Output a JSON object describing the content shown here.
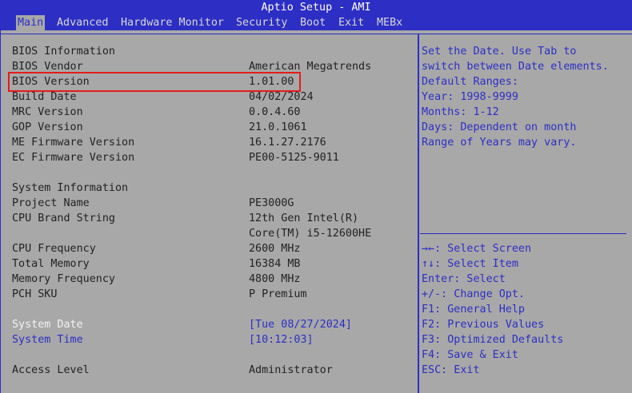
{
  "window": {
    "title": "Aptio Setup - AMI"
  },
  "menu": {
    "tabs": [
      {
        "label": "Main"
      },
      {
        "label": "Advanced"
      },
      {
        "label": "Hardware Monitor"
      },
      {
        "label": "Security"
      },
      {
        "label": "Boot"
      },
      {
        "label": "Exit"
      },
      {
        "label": "MEBx"
      }
    ]
  },
  "bios_info": {
    "heading": "BIOS Information",
    "rows": [
      {
        "label": "BIOS Vendor",
        "value": "American Megatrends"
      },
      {
        "label": "BIOS Version",
        "value": "1.01.00"
      },
      {
        "label": "Build Date",
        "value": "04/02/2024"
      },
      {
        "label": "MRC Version",
        "value": "0.0.4.60"
      },
      {
        "label": "GOP Version",
        "value": "21.0.1061"
      },
      {
        "label": "ME Firmware Version",
        "value": "16.1.27.2176"
      },
      {
        "label": "EC Firmware Version",
        "value": "PE00-5125-9011"
      }
    ]
  },
  "system_info": {
    "heading": "System Information",
    "rows": [
      {
        "label": "Project Name",
        "value": "PE3000G"
      },
      {
        "label": "CPU Brand String",
        "value": "12th Gen Intel(R)"
      },
      {
        "label": "",
        "value": "Core(TM) i5-12600HE"
      },
      {
        "label": "CPU Frequency",
        "value": "2600 MHz"
      },
      {
        "label": "Total Memory",
        "value": "16384 MB"
      },
      {
        "label": "Memory Frequency",
        "value": "4800 MHz"
      },
      {
        "label": "PCH SKU",
        "value": "P Premium"
      }
    ]
  },
  "system_date": {
    "label": "System Date",
    "value": "[Tue 08/27/2024]"
  },
  "system_time": {
    "label": "System Time",
    "value": "[10:12:03]"
  },
  "access_level": {
    "label": "Access Level",
    "value": "Administrator"
  },
  "help_text": [
    "Set the Date. Use Tab to",
    "switch between Date elements.",
    "Default Ranges:",
    "Year: 1998-9999",
    "Months: 1-12",
    "Days: Dependent on month",
    "Range of Years may vary."
  ],
  "key_help": [
    "→←: Select Screen",
    "↑↓: Select Item",
    "Enter: Select",
    "+/-: Change Opt.",
    "F1: General Help",
    "F2: Previous Values",
    "F3: Optimized Defaults",
    "F4: Save & Exit",
    "ESC: Exit"
  ],
  "colors": {
    "background": "#a8a8a8",
    "accent": "#2d2ec4",
    "highlight": "#e21d1d"
  }
}
